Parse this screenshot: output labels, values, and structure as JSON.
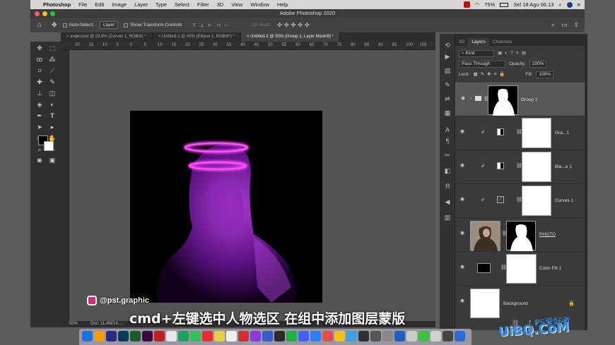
{
  "menubar": {
    "apple": "",
    "app": "Photoshop",
    "items": [
      "File",
      "Edit",
      "Image",
      "Layer",
      "Type",
      "Select",
      "Filter",
      "3D",
      "View",
      "Window",
      "Help"
    ],
    "battery": "75%",
    "datetime": "Sel 18 Agu 06.13"
  },
  "window": {
    "title": "Adobe Photoshop 2020"
  },
  "options": {
    "auto_select_label": "Auto-Select:",
    "auto_select_value": "Layer",
    "transform_label": "Show Transform Controls",
    "mode3d": "3D Mode:"
  },
  "tabs": [
    "angel.psd @ 23,8% (Curves 1, RGB/8) *",
    "Untitled-1 @ 40% (Ellipse 1, RGB/8*) *",
    "Untitled-2 @ 50% (Group 1, Layer Mask/8) *"
  ],
  "ruler": [
    "20",
    "15",
    "10",
    "5",
    "0",
    "5",
    "10",
    "15",
    "20",
    "25",
    "30",
    "35",
    "40",
    "45",
    "50",
    "55",
    "60",
    "65",
    "70",
    "75",
    "80",
    "85",
    "90",
    "95",
    "100",
    "105"
  ],
  "status": {
    "zoom": "50%",
    "doc": "Doc: 11,4M/14,..."
  },
  "panel": {
    "tabs": [
      "3D",
      "Layers",
      "Channels"
    ],
    "filter": "Kind",
    "blend": "Pass Through",
    "opacity_label": "Opacity:",
    "opacity": "100%",
    "lock_label": "Lock:",
    "fill_label": "Fill:",
    "fill": "100%"
  },
  "layers": [
    {
      "name": "Group 1"
    },
    {
      "name": "Gra...1"
    },
    {
      "name": "Bla...e 1"
    },
    {
      "name": "Curves 1"
    },
    {
      "name": "PHOTO"
    },
    {
      "name": "Color Fill 1"
    },
    {
      "name": "Background"
    }
  ],
  "overlay": {
    "handle": "@pst.graphic",
    "caption": "cmd+左键选中人物选区 在组中添加图层蒙版",
    "watermark": "UiBQ.CoM",
    "watermark_cn": "PS爱好者"
  },
  "colors": {
    "neon": "#ff4dff",
    "accent": "#2c8cf5"
  }
}
